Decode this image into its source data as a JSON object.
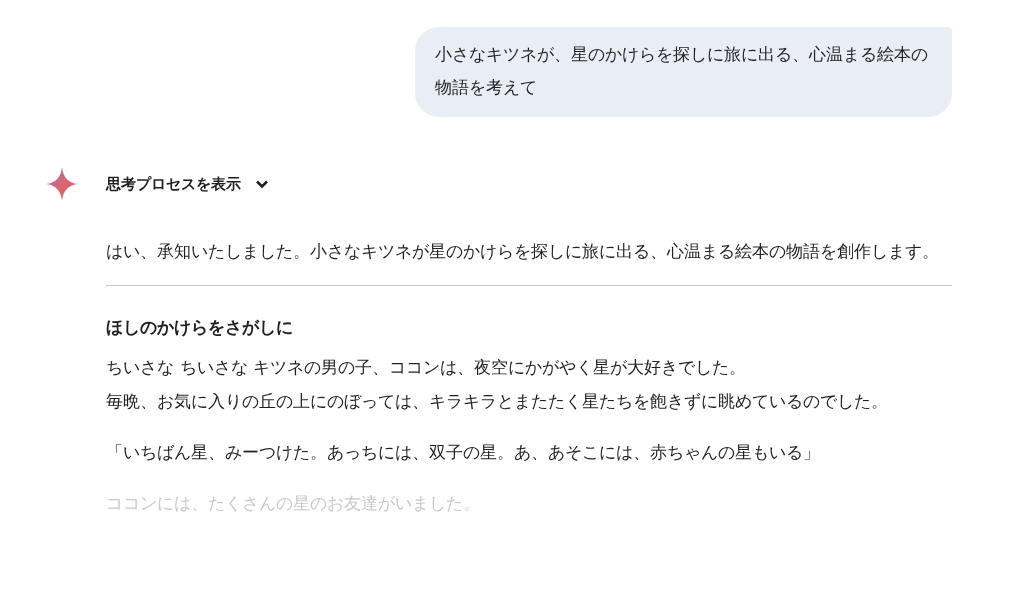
{
  "user_message": {
    "text": "小さなキツネが、星のかけらを探しに旅に出る、心温まる絵本の物語を考えて"
  },
  "response": {
    "thoughts_toggle": {
      "label": "思考プロセスを表示",
      "expanded": false
    },
    "intro": "はい、承知いたしました。小さなキツネが星のかけらを探しに旅に出る、心温まる絵本の物語を創作します。",
    "story": [
      {
        "kind": "heading",
        "text": "ほしのかけらをさがしに",
        "faded": false
      },
      {
        "kind": "line",
        "text": "ちいさな ちいさな キツネの男の子、ココンは、夜空にかがやく星が大好きでした。",
        "faded": false
      },
      {
        "kind": "paragraph",
        "text": "毎晩、お気に入りの丘の上にのぼっては、キラキラとまたたく星たちを飽きずに眺めているのでした。",
        "faded": false
      },
      {
        "kind": "paragraph",
        "text": "「いちばん星、みーつけた。あっちには、双子の星。あ、あそこには、赤ちゃんの星もいる」",
        "faded": false
      },
      {
        "kind": "paragraph",
        "text": "ココンには、たくさんの星のお友達がいました。",
        "faded": true
      }
    ]
  }
}
